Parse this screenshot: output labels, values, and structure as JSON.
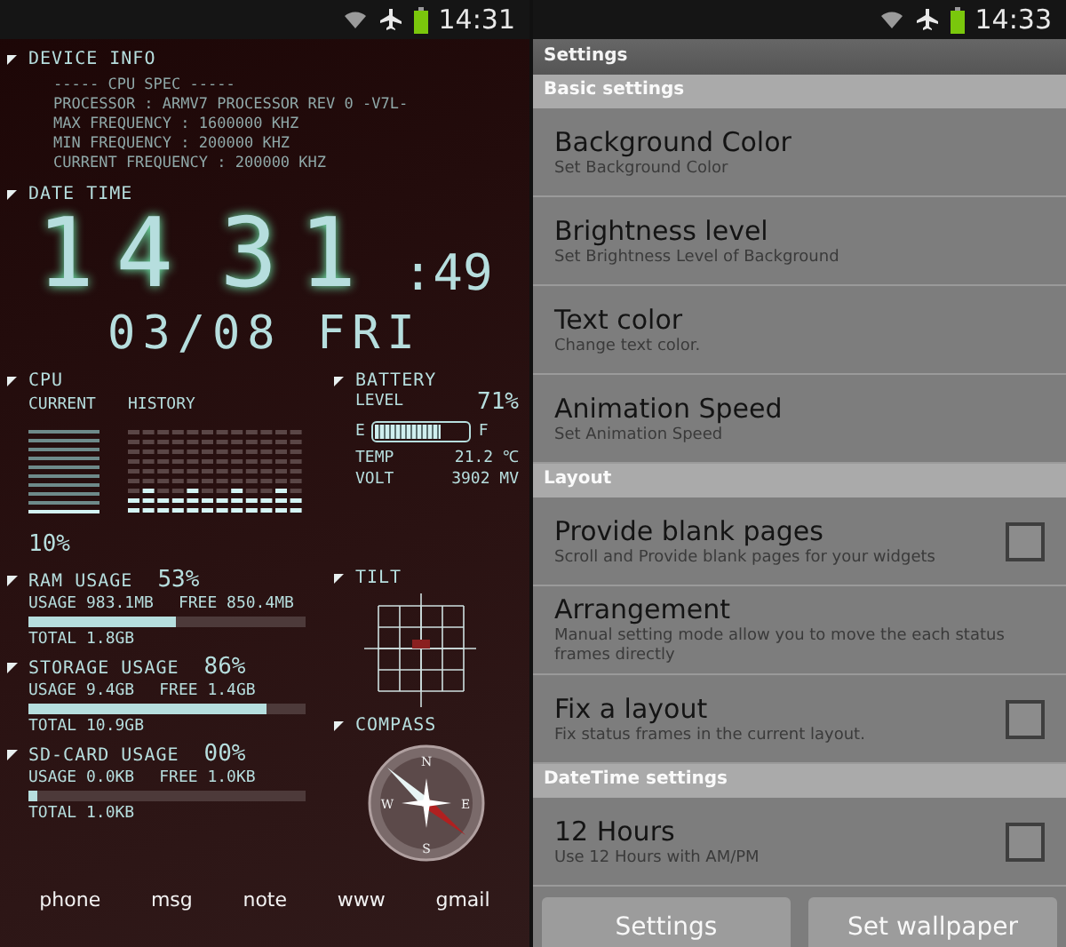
{
  "wallpaper_screen": {
    "status_bar": {
      "time": "14:31"
    },
    "device_info": {
      "title": "DEVICE INFO",
      "lines": [
        "-----  CPU SPEC  -----",
        "PROCESSOR : ARMV7 PROCESSOR REV 0 -V7L-",
        "MAX FREQUENCY : 1600000 KHZ",
        "MIN FREQUENCY : 200000 KHZ",
        "CURRENT FREQUENCY : 200000 KHZ"
      ]
    },
    "date_time": {
      "title": "DATE TIME",
      "hour": "14",
      "minute": "31",
      "seconds": ":49",
      "date": "03/08 FRI"
    },
    "cpu": {
      "title": "CPU",
      "current_label": "CURRENT",
      "history_label": "HISTORY",
      "level": 0.1,
      "reading": "10%"
    },
    "battery": {
      "title": "BATTERY",
      "level_label": "LEVEL",
      "reading": "71%",
      "level": 0.71,
      "empty_label": "E",
      "full_label": "F",
      "temp_label": "TEMP",
      "temp": "21.2 ℃",
      "volt_label": "VOLT",
      "volt": "3902 MV"
    },
    "usages": [
      {
        "title": "RAM USAGE",
        "percent": "53%",
        "usage": "USAGE 983.1MB",
        "free": "FREE 850.4MB",
        "level": 0.53,
        "total": "TOTAL 1.8GB"
      },
      {
        "title": "STORAGE USAGE",
        "percent": "86%",
        "usage": "USAGE 9.4GB",
        "free": "FREE 1.4GB",
        "level": 0.86,
        "total": "TOTAL 10.9GB"
      },
      {
        "title": "SD-CARD USAGE",
        "percent": "00%",
        "usage": "USAGE 0.0KB",
        "free": "FREE 1.0KB",
        "level": 0.03,
        "total": "TOTAL 1.0KB"
      }
    ],
    "tilt": {
      "title": "TILT"
    },
    "compass": {
      "title": "COMPASS",
      "directions": [
        "N",
        "E",
        "S",
        "W"
      ]
    },
    "dock": [
      "phone",
      "msg",
      "note",
      "www",
      "gmail"
    ]
  },
  "settings_screen": {
    "status_bar": {
      "time": "14:33"
    },
    "title": "Settings",
    "sections": [
      {
        "header": "Basic settings",
        "items": [
          {
            "kind": "plain",
            "title": "Background Color",
            "summary": "Set Background Color"
          },
          {
            "kind": "plain",
            "title": "Brightness level",
            "summary": "Set Brightness Level of Background"
          },
          {
            "kind": "plain",
            "title": "Text color",
            "summary": "Change text color."
          },
          {
            "kind": "plain",
            "title": "Animation Speed",
            "summary": "Set Animation Speed"
          }
        ]
      },
      {
        "header": "Layout",
        "items": [
          {
            "kind": "checkbox",
            "title": "Provide blank pages",
            "summary": "Scroll and Provide blank pages for your widgets",
            "checked": false
          },
          {
            "kind": "plain",
            "title": "Arrangement",
            "summary": "Manual setting mode allow you to move the each status frames directly"
          },
          {
            "kind": "checkbox",
            "title": "Fix a layout",
            "summary": "Fix status frames in the current layout.",
            "checked": false
          }
        ]
      },
      {
        "header": "DateTime settings",
        "items": [
          {
            "kind": "checkbox",
            "title": "12 Hours",
            "summary": "Use 12 Hours with AM/PM",
            "checked": false
          }
        ]
      }
    ],
    "buttons": [
      "Settings",
      "Set wallpaper"
    ]
  }
}
